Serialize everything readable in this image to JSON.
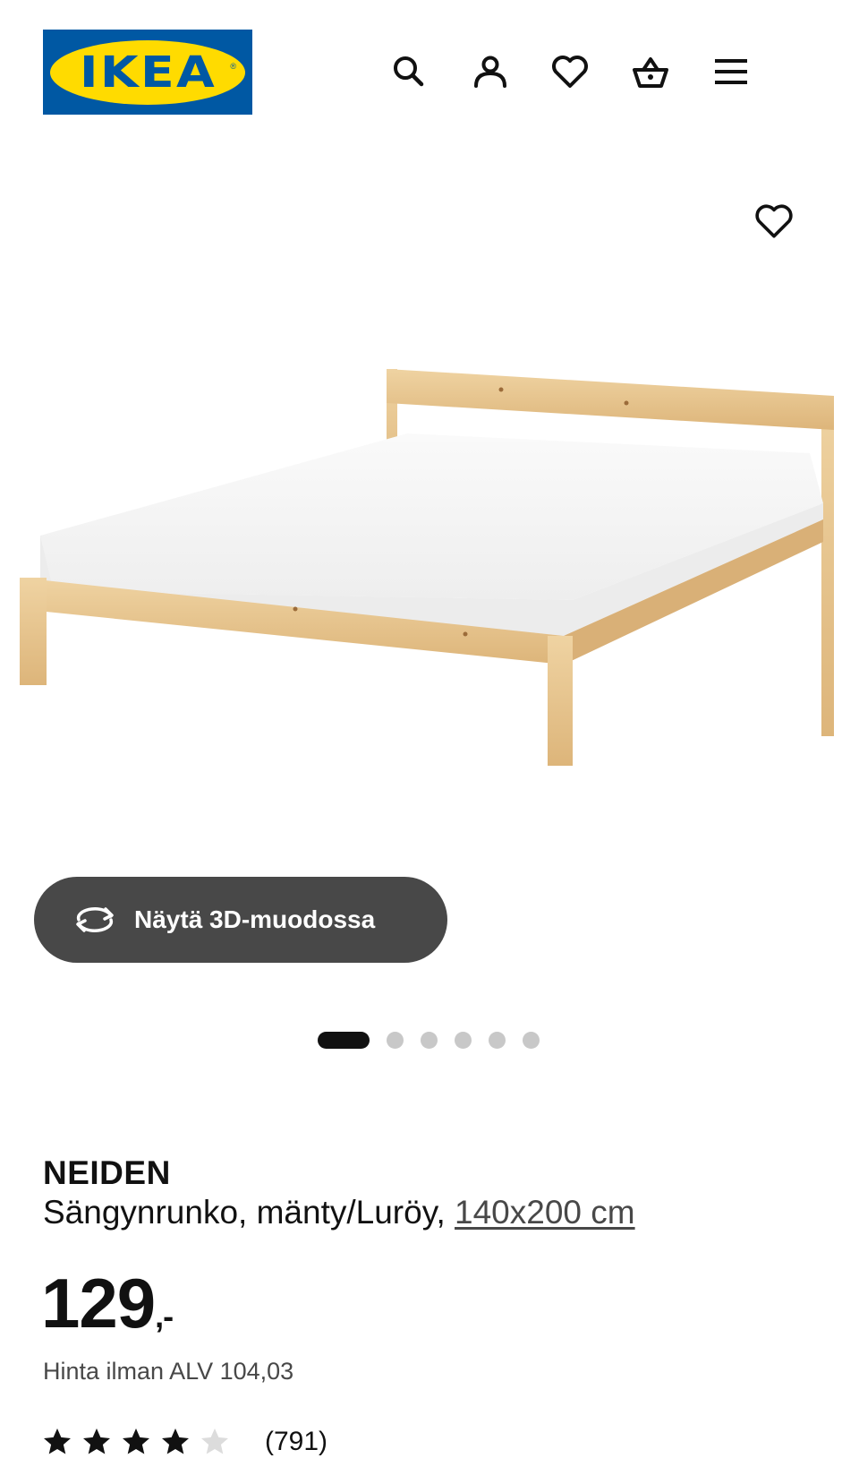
{
  "header": {
    "logo_text": "IKEA",
    "logo_reg": "®",
    "icons": [
      "search-icon",
      "user-icon",
      "heart-icon",
      "basket-icon",
      "menu-icon"
    ]
  },
  "gallery": {
    "view_3d_label": "Näytä 3D-muodossa",
    "image_count": 6,
    "active_index": 0
  },
  "product": {
    "name": "NEIDEN",
    "description": "Sängynrunko, mänty/Luröy, ",
    "size": "140x200 cm",
    "price": "129",
    "price_suffix": ",-",
    "vat_text": "Hinta ilman ALV 104,03",
    "rating_value": 4,
    "rating_max": 5,
    "review_count": "(791)"
  },
  "colors": {
    "ikea_blue": "#0058a3",
    "ikea_yellow": "#ffdb00",
    "wood": "#e8c48c",
    "button_dark": "#484848"
  }
}
